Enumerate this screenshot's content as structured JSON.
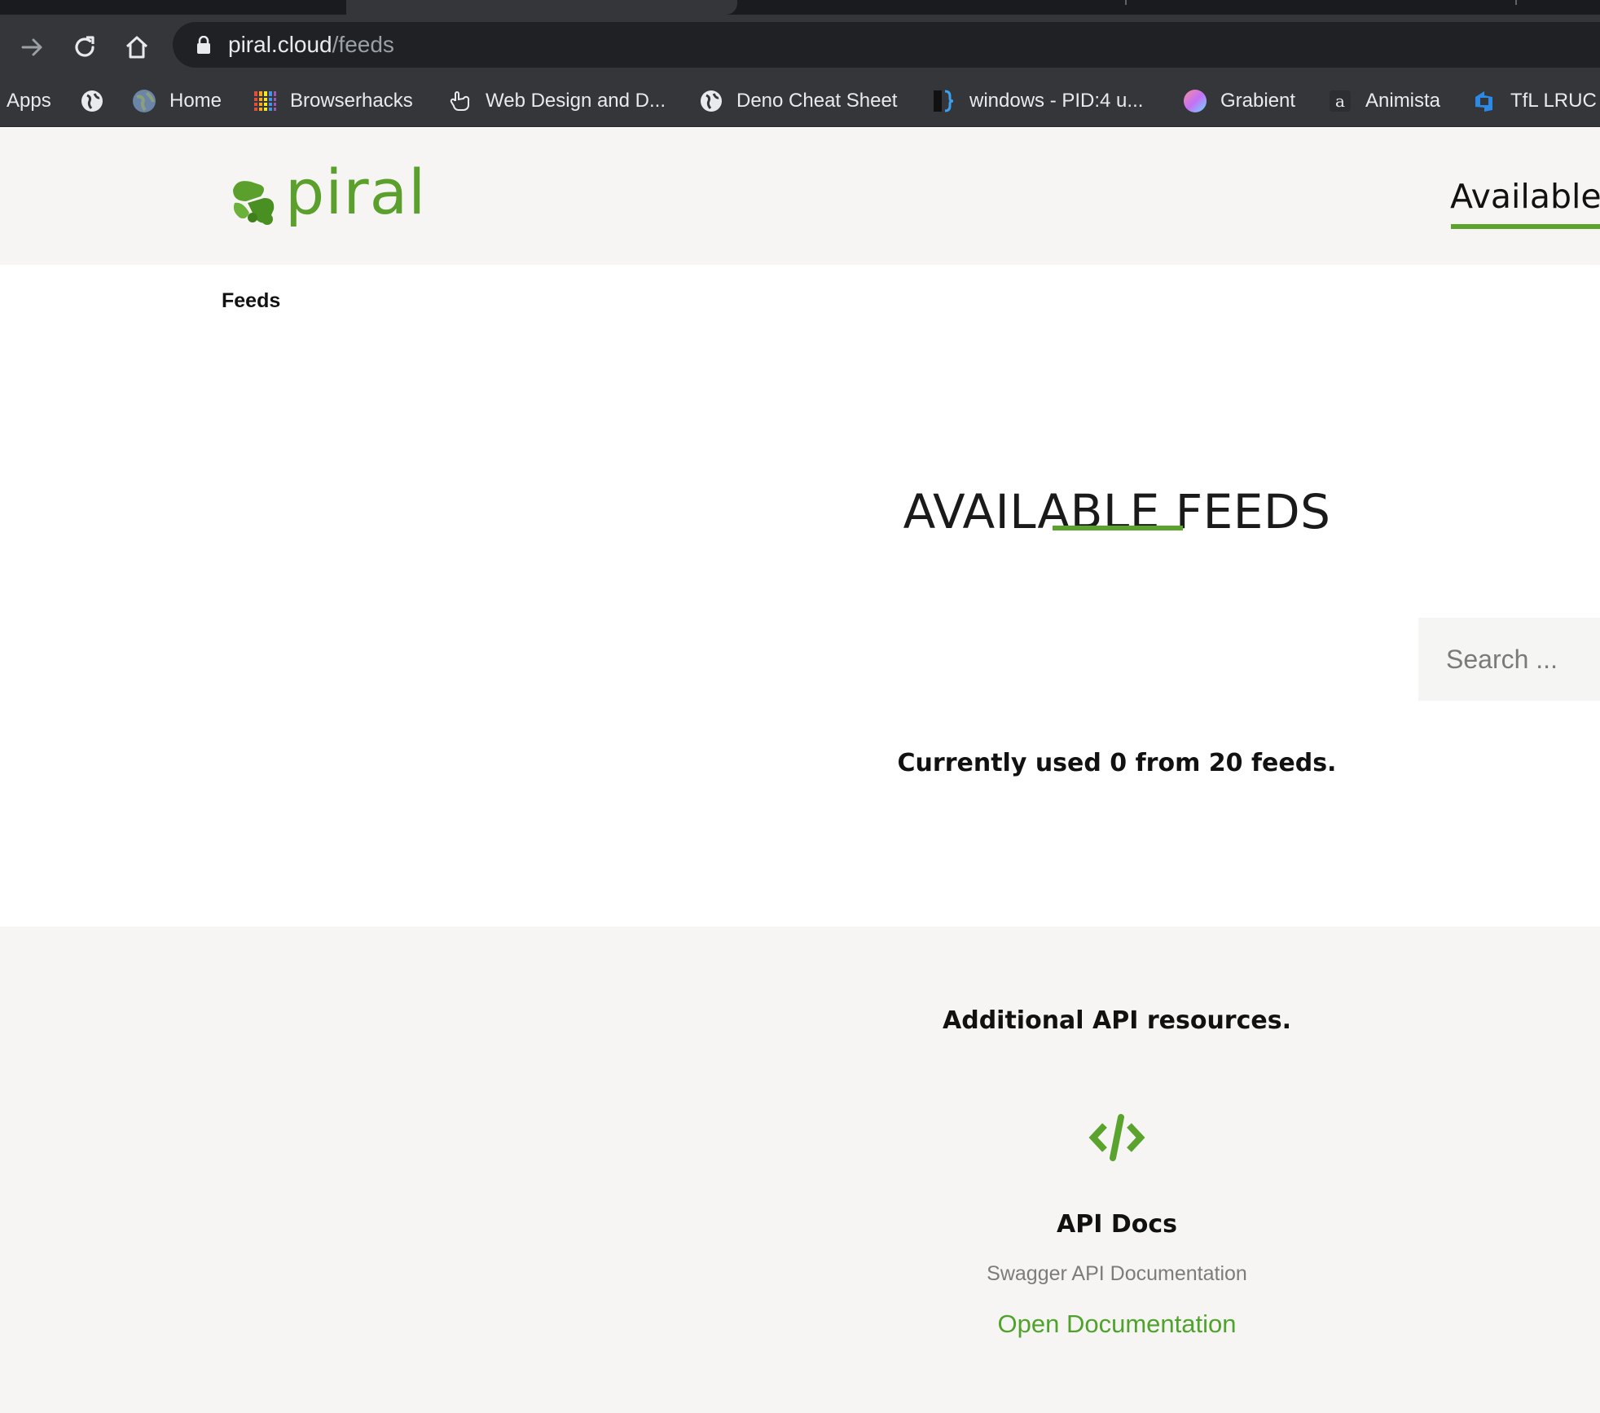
{
  "browser": {
    "url_host": "piral.cloud",
    "url_path": "/feeds",
    "bookmarks": [
      {
        "label": "Apps",
        "icon": "apps-icon"
      },
      {
        "label": "",
        "icon": "globe-icon"
      },
      {
        "label": "Home",
        "icon": "earth-icon"
      },
      {
        "label": "Browserhacks",
        "icon": "grid-icon"
      },
      {
        "label": "Web Design and D...",
        "icon": "hand-icon"
      },
      {
        "label": "Deno Cheat Sheet",
        "icon": "globe-icon"
      },
      {
        "label": "windows - PID:4 u...",
        "icon": "bracket-icon"
      },
      {
        "label": "Grabient",
        "icon": "gradient-icon"
      },
      {
        "label": "Animista",
        "icon": "letter-a-icon"
      },
      {
        "label": "TfL LRUC",
        "icon": "azure-icon"
      }
    ]
  },
  "header": {
    "logo_text": "piral",
    "nav_item": "Available"
  },
  "breadcrumb": "Feeds",
  "main": {
    "title": "AVAILABLE FEEDS",
    "search_placeholder": "Search ...",
    "usage_text": "Currently used 0 from 20 feeds."
  },
  "resources": {
    "heading": "Additional API resources.",
    "card": {
      "icon": "code-icon",
      "title": "API Docs",
      "subtitle": "Swagger API Documentation",
      "link_label": "Open Documentation"
    }
  },
  "colors": {
    "accent": "#5aa42e",
    "chrome_bg": "#35363a",
    "omnibox_bg": "#202124",
    "section_bg": "#f6f5f3"
  }
}
